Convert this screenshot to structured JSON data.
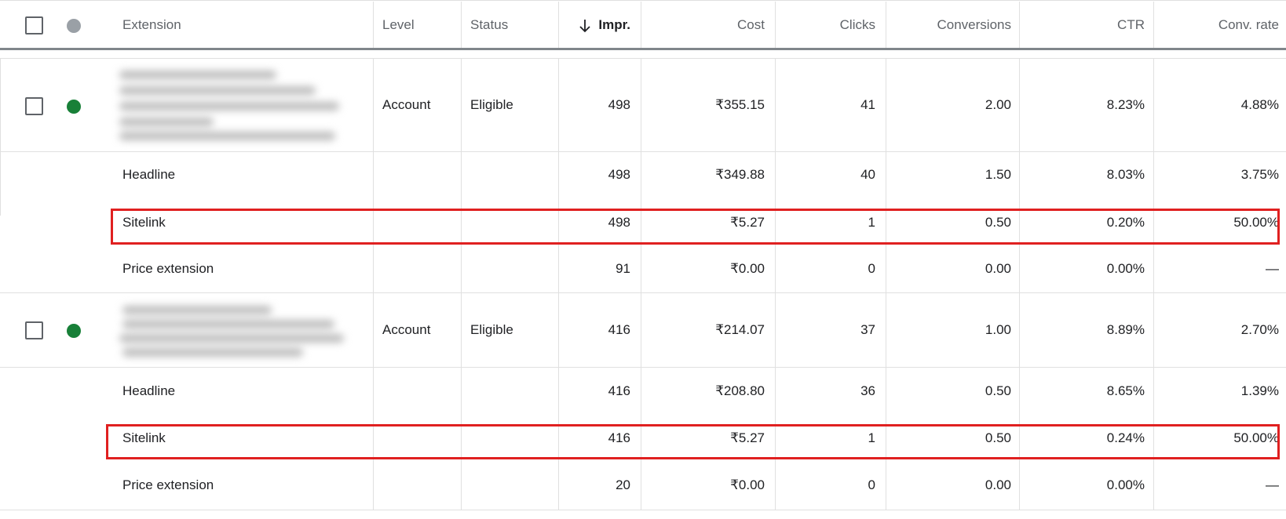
{
  "colors": {
    "eligible_dot": "#188038",
    "header_dot": "#9aa0a6",
    "highlight_border": "#e02020"
  },
  "icons": {
    "sort": "arrow-down-icon",
    "status_eligible": "green-dot-icon",
    "status_header": "gray-dot-icon"
  },
  "header": {
    "extension": "Extension",
    "level": "Level",
    "status": "Status",
    "impr": "Impr.",
    "cost": "Cost",
    "clicks": "Clicks",
    "conversions": "Conversions",
    "ctr": "CTR",
    "conv_rate": "Conv. rate"
  },
  "groups": [
    {
      "level": "Account",
      "status": "Eligible",
      "impr": "498",
      "cost": "₹355.15",
      "clicks": "41",
      "conversions": "2.00",
      "ctr": "8.23%",
      "conv_rate": "4.88%",
      "subrows": [
        {
          "type": "Headline",
          "impr": "498",
          "cost": "₹349.88",
          "clicks": "40",
          "conversions": "1.50",
          "ctr": "8.03%",
          "conv_rate": "3.75%"
        },
        {
          "type": "Sitelink",
          "impr": "498",
          "cost": "₹5.27",
          "clicks": "1",
          "conversions": "0.50",
          "ctr": "0.20%",
          "conv_rate": "50.00%"
        },
        {
          "type": "Price extension",
          "impr": "91",
          "cost": "₹0.00",
          "clicks": "0",
          "conversions": "0.00",
          "ctr": "0.00%",
          "conv_rate": "—"
        }
      ]
    },
    {
      "level": "Account",
      "status": "Eligible",
      "impr": "416",
      "cost": "₹214.07",
      "clicks": "37",
      "conversions": "1.00",
      "ctr": "8.89%",
      "conv_rate": "2.70%",
      "subrows": [
        {
          "type": "Headline",
          "impr": "416",
          "cost": "₹208.80",
          "clicks": "36",
          "conversions": "0.50",
          "ctr": "8.65%",
          "conv_rate": "1.39%"
        },
        {
          "type": "Sitelink",
          "impr": "416",
          "cost": "₹5.27",
          "clicks": "1",
          "conversions": "0.50",
          "ctr": "0.24%",
          "conv_rate": "50.00%"
        },
        {
          "type": "Price extension",
          "impr": "20",
          "cost": "₹0.00",
          "clicks": "0",
          "conversions": "0.00",
          "ctr": "0.00%",
          "conv_rate": "—"
        }
      ]
    }
  ]
}
